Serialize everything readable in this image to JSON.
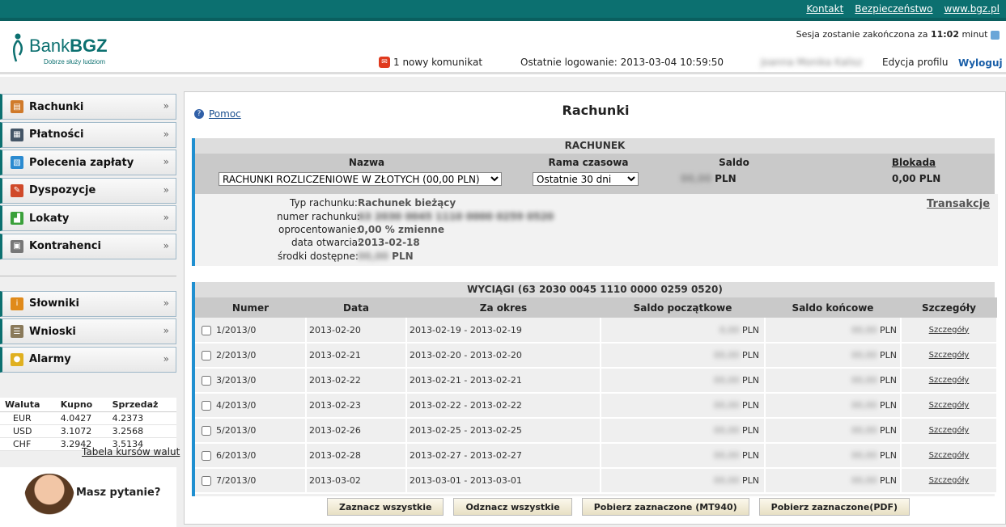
{
  "toplinks": [
    "Kontakt",
    "Bezpieczeństwo",
    "www.bgz.pl"
  ],
  "logo": {
    "bank": "Bank",
    "brand": "BGZ",
    "motto": "Dobrze służy ludziom"
  },
  "session": {
    "prefix": "Sesja zostanie zakończona za",
    "time": "11:02",
    "suffix": "minut"
  },
  "header": {
    "message": "1 nowy komunikat",
    "last_login": "Ostatnie logowanie: 2013-03-04 10:59:50",
    "username": "Joanna Monika Kalisz",
    "profile": "Edycja profilu",
    "logout": "Wyloguj"
  },
  "menu": [
    {
      "label": "Rachunki",
      "icon": "ledger-icon",
      "color": "#d07a2a"
    },
    {
      "label": "Płatności",
      "icon": "calculator-icon",
      "color": "#445566"
    },
    {
      "label": "Polecenia zapłaty",
      "icon": "document-icon",
      "color": "#2a8ad0"
    },
    {
      "label": "Dyspozycje",
      "icon": "pencil-icon",
      "color": "#d04a2a"
    },
    {
      "label": "Lokaty",
      "icon": "chart-icon",
      "color": "#3aa03a"
    },
    {
      "label": "Kontrahenci",
      "icon": "contacts-icon",
      "color": "#777777"
    }
  ],
  "menu2": [
    {
      "label": "Słowniki",
      "icon": "info-icon",
      "color": "#e08a1a"
    },
    {
      "label": "Wnioski",
      "icon": "list-icon",
      "color": "#8a7a5a"
    },
    {
      "label": "Alarmy",
      "icon": "bulb-icon",
      "color": "#e0b020"
    }
  ],
  "rates": {
    "headers": [
      "Waluta",
      "Kupno",
      "Sprzedaż"
    ],
    "rows": [
      [
        "EUR",
        "4.0427",
        "4.2373"
      ],
      [
        "USD",
        "3.1072",
        "3.2568"
      ],
      [
        "CHF",
        "3.2942",
        "3.5134"
      ]
    ],
    "link": "Tabela kursów walut"
  },
  "helpbox": {
    "question": "Masz pytanie?"
  },
  "main": {
    "help": "Pomoc",
    "title": "Rachunki"
  },
  "account": {
    "banner": "RACHUNEK",
    "col_name": "Nazwa",
    "col_period": "Rama czasowa",
    "col_balance": "Saldo",
    "col_block": "Blokada",
    "select_value": "RACHUNKI ROZLICZENIOWE W ZŁOTYCH (00,00 PLN)",
    "period_value": "Ostatnie 30 dni",
    "balance": "00,00",
    "currency": "PLN",
    "block": "0,00 PLN",
    "transactions": "Transakcje",
    "labels": [
      "Typ rachunku:",
      "numer rachunku:",
      "oprocentowanie:",
      "data otwarcia:",
      "środki dostępne:"
    ],
    "type": "Rachunek bieżący",
    "number": "63 2030 0045 1110 0000 0259 0520",
    "interest": "0,00 % zmienne",
    "opened": "2013-02-18",
    "available": "00,00"
  },
  "statements": {
    "banner": "WYCIĄGI (63 2030 0045 1110 0000 0259 0520)",
    "headers": [
      "Numer",
      "Data",
      "Za okres",
      "Saldo początkowe",
      "Saldo końcowe",
      "Szczegóły"
    ],
    "rows": [
      {
        "num": "1/2013/0",
        "date": "2013-02-20",
        "period": "2013-02-19 - 2013-02-19",
        "start": "0,00",
        "end": "00,00"
      },
      {
        "num": "2/2013/0",
        "date": "2013-02-21",
        "period": "2013-02-20 - 2013-02-20",
        "start": "00,00",
        "end": "00,00"
      },
      {
        "num": "3/2013/0",
        "date": "2013-02-22",
        "period": "2013-02-21 - 2013-02-21",
        "start": "00,00",
        "end": "00,00"
      },
      {
        "num": "4/2013/0",
        "date": "2013-02-23",
        "period": "2013-02-22 - 2013-02-22",
        "start": "00,00",
        "end": "00,00"
      },
      {
        "num": "5/2013/0",
        "date": "2013-02-26",
        "period": "2013-02-25 - 2013-02-25",
        "start": "00,00",
        "end": "00,00"
      },
      {
        "num": "6/2013/0",
        "date": "2013-02-28",
        "period": "2013-02-27 - 2013-02-27",
        "start": "00,00",
        "end": "00,00"
      },
      {
        "num": "7/2013/0",
        "date": "2013-03-02",
        "period": "2013-03-01 - 2013-03-01",
        "start": "00,00",
        "end": "00,00"
      }
    ],
    "currency": "PLN",
    "details_link": "Szczegóły"
  },
  "buttons": [
    "Zaznacz wszystkie",
    "Odznacz wszystkie",
    "Pobierz zaznaczone (MT940)",
    "Pobierz zaznaczone(PDF)"
  ]
}
